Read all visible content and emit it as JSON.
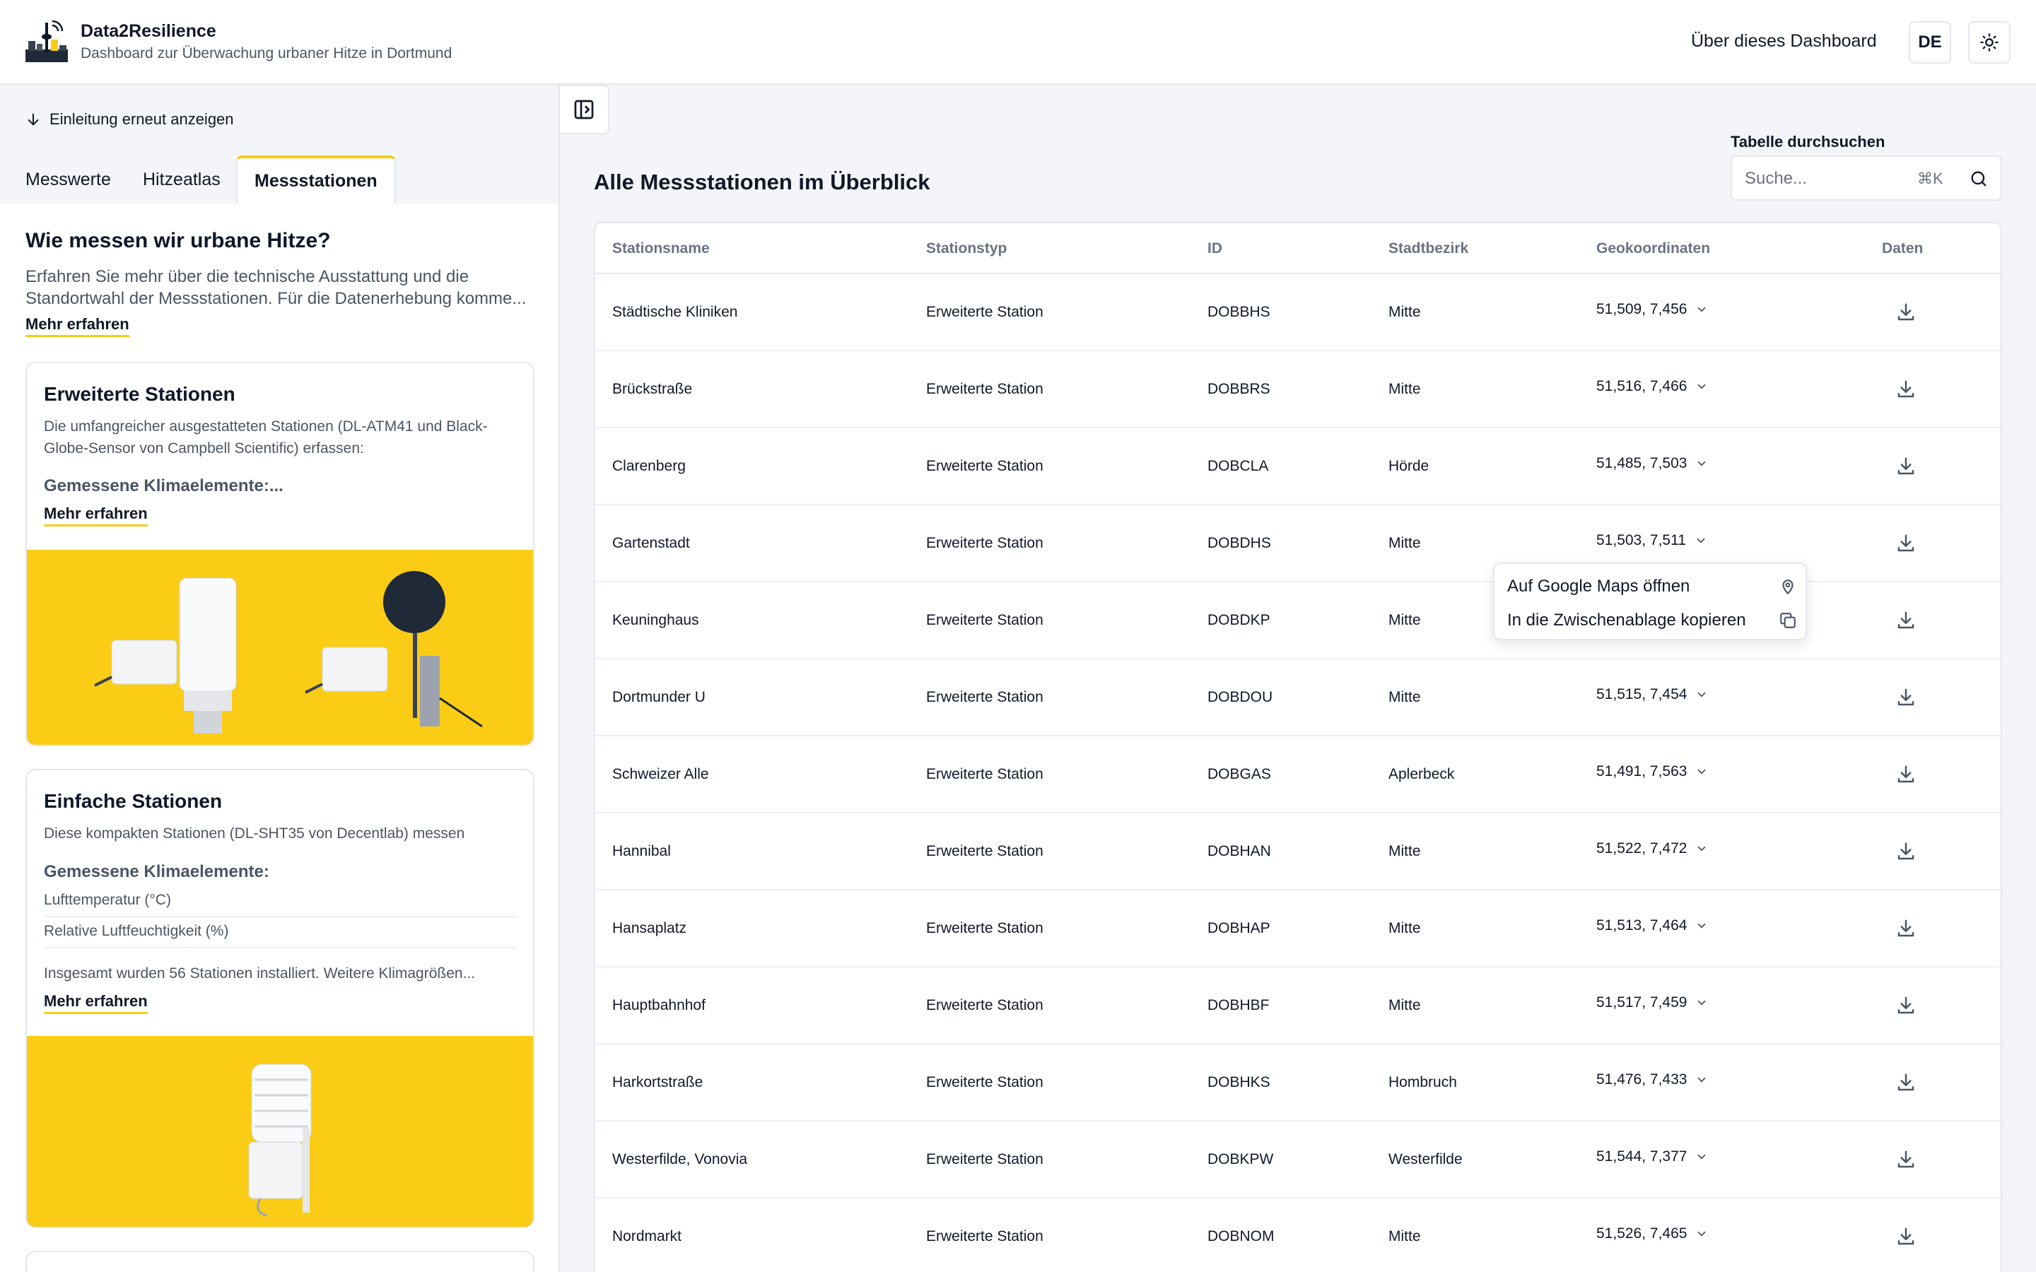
{
  "header": {
    "title": "Data2Resilience",
    "subtitle": "Dashboard zur Überwachung urbaner Hitze in Dortmund",
    "about": "Über dieses Dashboard",
    "lang": "DE"
  },
  "sidebar": {
    "intro_link": "Einleitung erneut anzeigen",
    "tabs": [
      {
        "label": "Messwerte"
      },
      {
        "label": "Hitzeatlas"
      },
      {
        "label": "Messstationen"
      }
    ],
    "panel": {
      "title": "Wie messen wir urbane Hitze?",
      "desc": "Erfahren Sie mehr über die technische Ausstattung und die Standortwahl der Messstationen. Für die Datenerhebung komme...",
      "more": "Mehr erfahren"
    },
    "cards": [
      {
        "title": "Erweiterte Stationen",
        "desc": "Die umfangreicher ausgestatteten Stationen (DL-ATM41 und Black-Globe-Sensor von Campbell Scientific) erfassen:",
        "sub": "Gemessene Klimaelemente:...",
        "more": "Mehr erfahren"
      },
      {
        "title": "Einfache Stationen",
        "desc": "Diese kompakten Stationen (DL-SHT35 von Decentlab) messen",
        "sub": "Gemessene Klimaelemente:",
        "items": [
          "Lufttemperatur (°C)",
          "Relative Luftfeuchtigkeit (%)"
        ],
        "note": "Insgesamt wurden 56 Stationen installiert. Weitere Klimagrößen...",
        "more": "Mehr erfahren"
      }
    ]
  },
  "main": {
    "title": "Alle Messstationen im Überblick",
    "search": {
      "label": "Tabelle durchsuchen",
      "placeholder": "Suche...",
      "shortcut": "⌘K"
    },
    "columns": [
      "Stationsname",
      "Stationstyp",
      "ID",
      "Stadtbezirk",
      "Geokoordinaten",
      "Daten"
    ],
    "rows": [
      {
        "name": "Städtische Kliniken",
        "type": "Erweiterte Station",
        "id": "DOBBHS",
        "district": "Mitte",
        "coords": "51,509, 7,456"
      },
      {
        "name": "Brückstraße",
        "type": "Erweiterte Station",
        "id": "DOBBRS",
        "district": "Mitte",
        "coords": "51,516, 7,466"
      },
      {
        "name": "Clarenberg",
        "type": "Erweiterte Station",
        "id": "DOBCLA",
        "district": "Hörde",
        "coords": "51,485, 7,503"
      },
      {
        "name": "Gartenstadt",
        "type": "Erweiterte Station",
        "id": "DOBDHS",
        "district": "Mitte",
        "coords": "51,503, 7,511"
      },
      {
        "name": "Keuninghaus",
        "type": "Erweiterte Station",
        "id": "DOBDKP",
        "district": "Mitte",
        "coords": ""
      },
      {
        "name": "Dortmunder U",
        "type": "Erweiterte Station",
        "id": "DOBDOU",
        "district": "Mitte",
        "coords": "51,515, 7,454"
      },
      {
        "name": "Schweizer Alle",
        "type": "Erweiterte Station",
        "id": "DOBGAS",
        "district": "Aplerbeck",
        "coords": "51,491, 7,563"
      },
      {
        "name": "Hannibal",
        "type": "Erweiterte Station",
        "id": "DOBHAN",
        "district": "Mitte",
        "coords": "51,522, 7,472"
      },
      {
        "name": "Hansaplatz",
        "type": "Erweiterte Station",
        "id": "DOBHAP",
        "district": "Mitte",
        "coords": "51,513, 7,464"
      },
      {
        "name": "Hauptbahnhof",
        "type": "Erweiterte Station",
        "id": "DOBHBF",
        "district": "Mitte",
        "coords": "51,517, 7,459"
      },
      {
        "name": "Harkortstraße",
        "type": "Erweiterte Station",
        "id": "DOBHKS",
        "district": "Hombruch",
        "coords": "51,476, 7,433"
      },
      {
        "name": "Westerfilde, Vonovia",
        "type": "Erweiterte Station",
        "id": "DOBKPW",
        "district": "Westerfilde",
        "coords": "51,544, 7,377"
      },
      {
        "name": "Nordmarkt",
        "type": "Erweiterte Station",
        "id": "DOBNOM",
        "district": "Mitte",
        "coords": "51,526, 7,465"
      }
    ],
    "popup": {
      "open_maps": "Auf Google Maps öffnen",
      "copy": "In die Zwischenablage kopieren"
    }
  },
  "colors": {
    "accent": "#facc15",
    "border": "#e5e7eb",
    "muted": "#6b7280"
  }
}
